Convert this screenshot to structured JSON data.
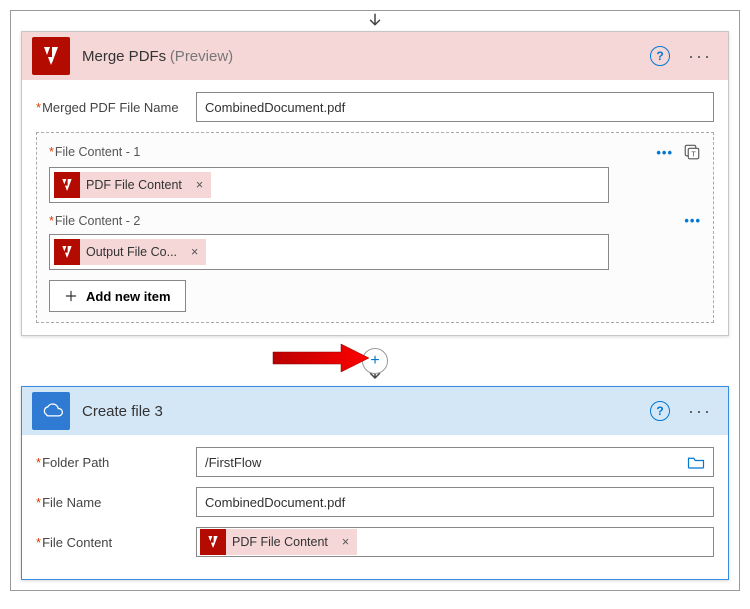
{
  "merge": {
    "title": "Merge PDFs",
    "preview": "(Preview)",
    "mergedLabel": "Merged PDF File Name",
    "mergedValue": "CombinedDocument.pdf",
    "fileContent1Label": "File Content - 1",
    "token1": "PDF File Content",
    "fileContent2Label": "File Content - 2",
    "token2": "Output File Co...",
    "addNewItem": "Add new item"
  },
  "createFile": {
    "title": "Create file 3",
    "folderLabel": "Folder Path",
    "folderValue": "/FirstFlow",
    "fileNameLabel": "File Name",
    "fileNameValue": "CombinedDocument.pdf",
    "fileContentLabel": "File Content",
    "token": "PDF File Content"
  },
  "symbols": {
    "required": "*",
    "help": "?",
    "more": "···",
    "plus": "+",
    "tokenX": "×"
  }
}
